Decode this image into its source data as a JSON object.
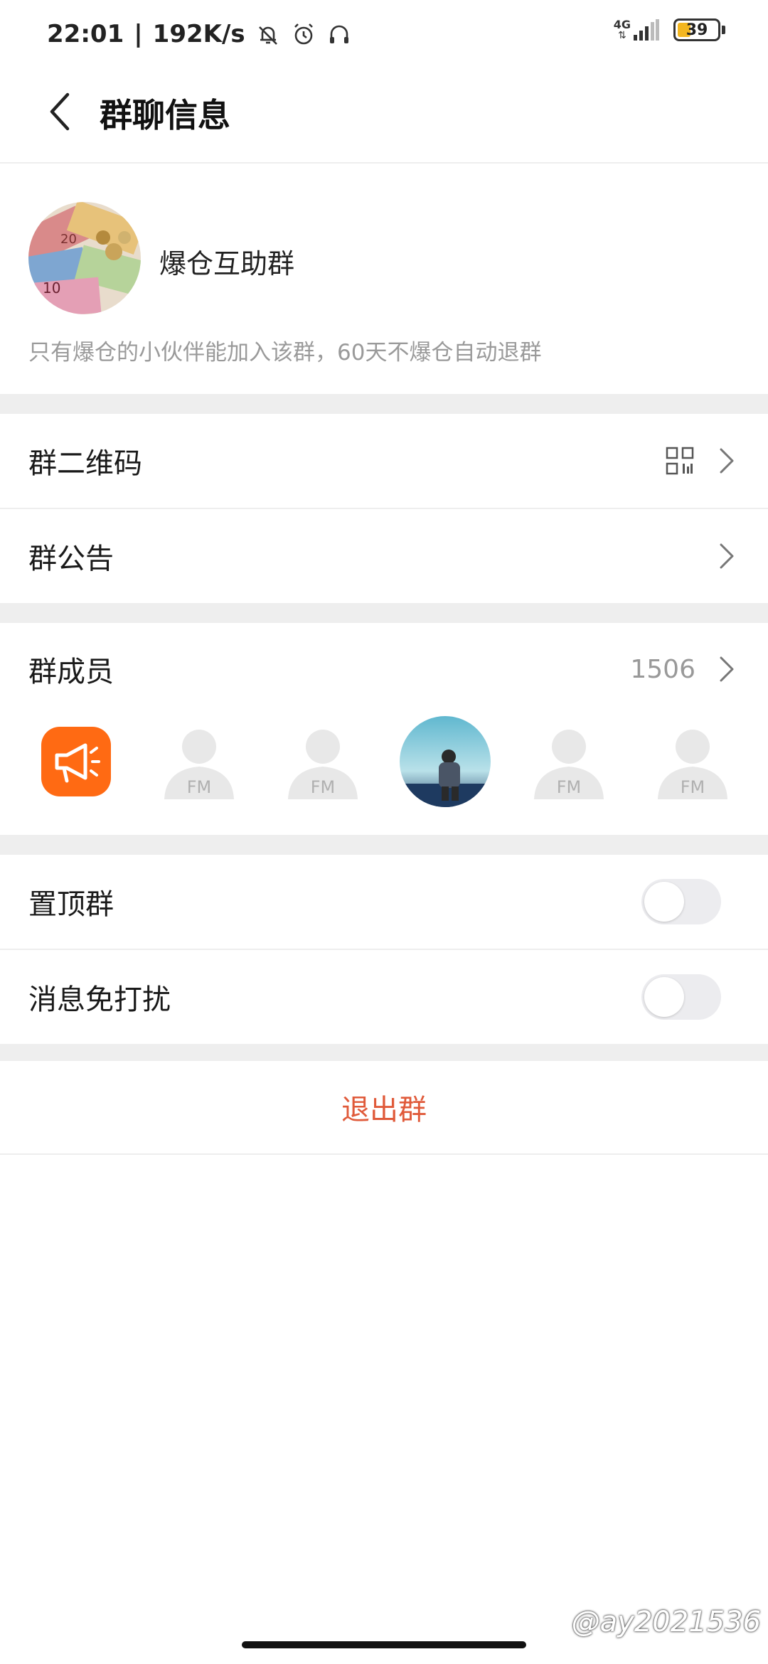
{
  "status_bar": {
    "time": "22:01",
    "separator": "|",
    "net_speed": "192K/s",
    "network_type": "4G",
    "battery": "39"
  },
  "header": {
    "title": "群聊信息"
  },
  "group": {
    "name": "爆仓互助群",
    "description": "只有爆仓的小伙伴能加入该群，60天不爆仓自动退群"
  },
  "rows": {
    "qr_code": "群二维码",
    "announcement": "群公告",
    "members": "群成员",
    "member_count": "1506",
    "pin": "置顶群",
    "mute": "消息免打扰"
  },
  "members": [
    {
      "type": "megaphone",
      "icon": "megaphone-icon"
    },
    {
      "type": "placeholder",
      "text": "FM"
    },
    {
      "type": "placeholder",
      "text": "FM"
    },
    {
      "type": "photo"
    },
    {
      "type": "placeholder",
      "text": "FM"
    },
    {
      "type": "placeholder",
      "text": "FM"
    }
  ],
  "toggles": {
    "pin": false,
    "mute": false
  },
  "exit_label": "退出群",
  "watermark": "@ay2021536",
  "colors": {
    "accent_orange": "#ff6a13",
    "exit_red": "#e05a3a",
    "battery_yellow": "#f3b61f"
  }
}
